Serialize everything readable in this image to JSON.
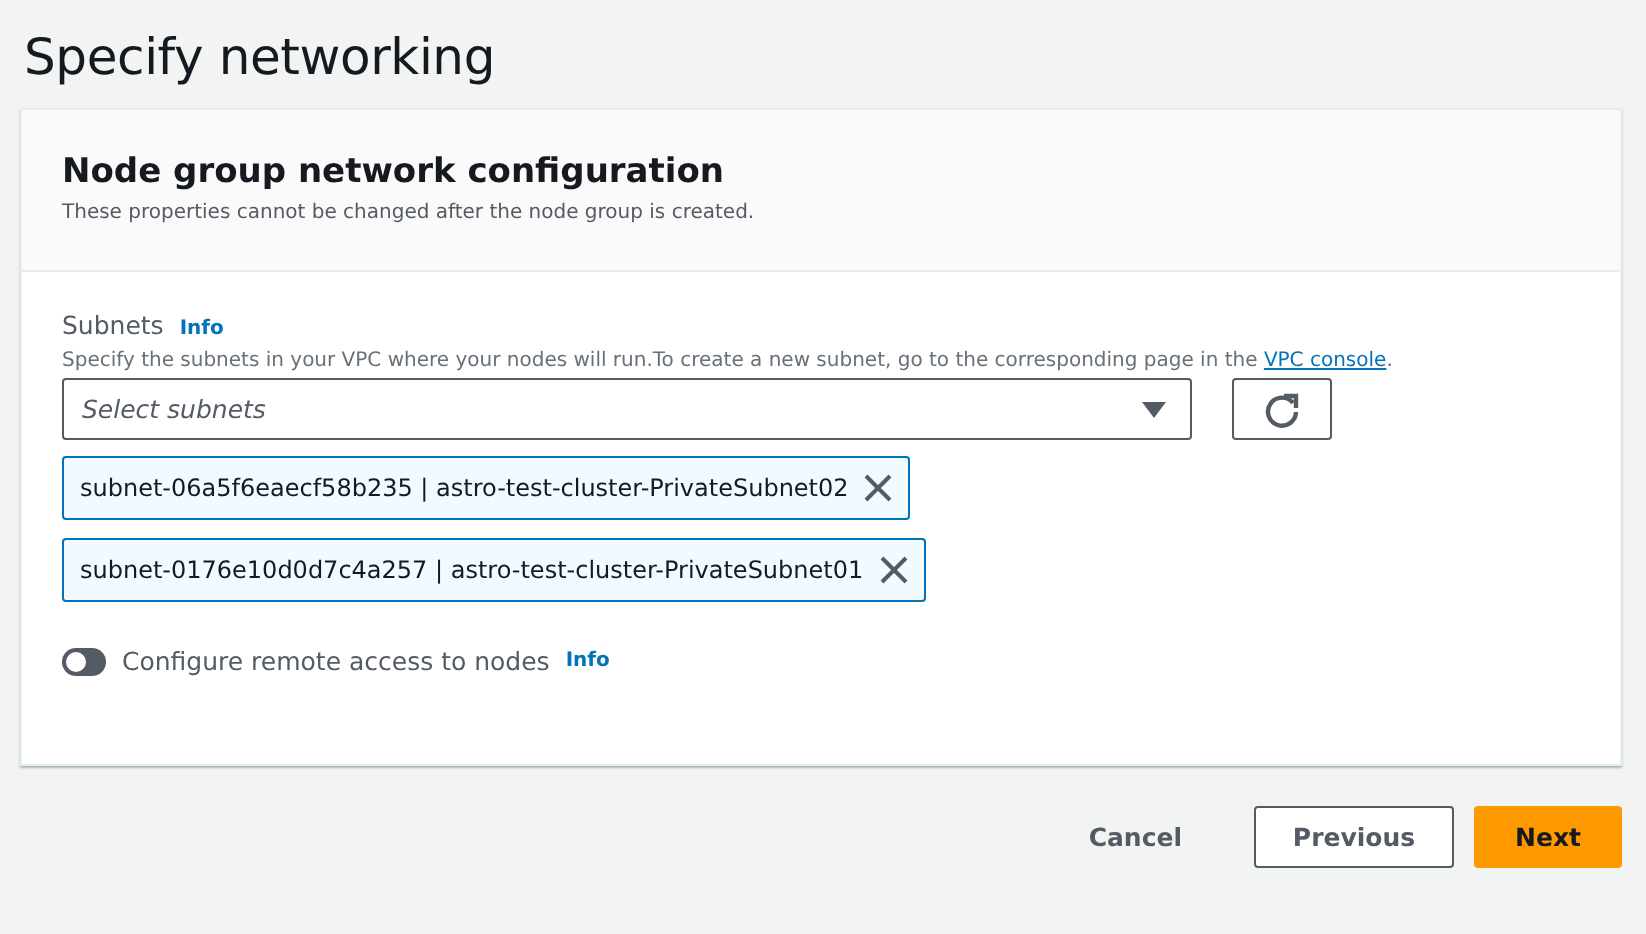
{
  "page_title": "Specify networking",
  "panel": {
    "title": "Node group network configuration",
    "description": "These properties cannot be changed after the node group is created."
  },
  "subnets": {
    "label": "Subnets",
    "info": "Info",
    "description": "Specify the subnets in your VPC where your nodes will run.To create a new subnet, go to the corresponding page in the ",
    "link": "VPC console",
    "description_end": ".",
    "placeholder": "Select subnets",
    "tokens": [
      {
        "label": "subnet-06a5f6eaecf58b235 | astro-test-cluster-PrivateSubnet02"
      },
      {
        "label": "subnet-0176e10d0d7c4a257 | astro-test-cluster-PrivateSubnet01"
      }
    ]
  },
  "remote_access": {
    "label": "Configure remote access to nodes",
    "info": "Info",
    "on": false
  },
  "buttons": [
    {
      "kind": "link",
      "label": "Cancel"
    },
    {
      "kind": "normal",
      "label": "Previous"
    },
    {
      "kind": "primary",
      "label": "Next"
    }
  ]
}
